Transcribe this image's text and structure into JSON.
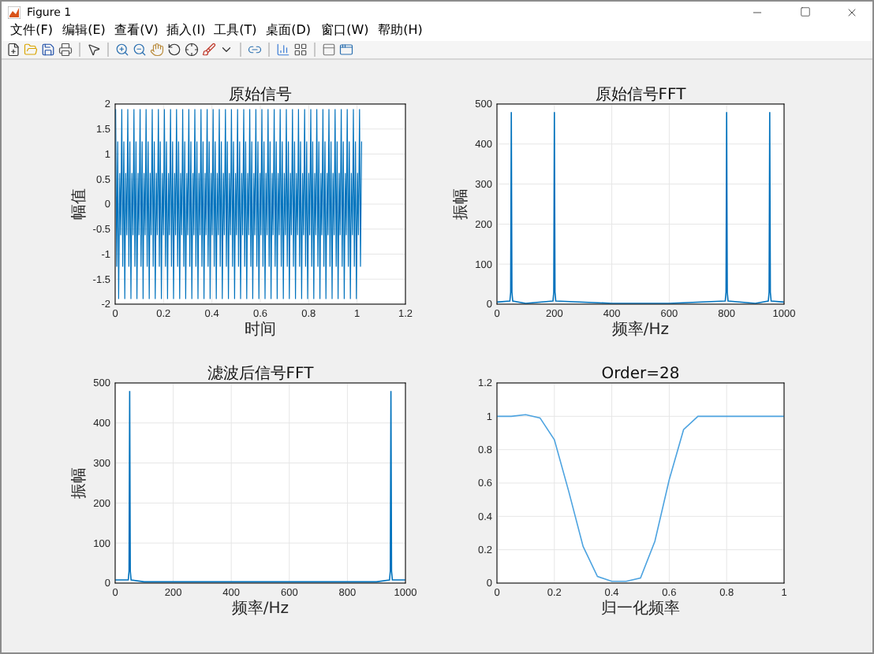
{
  "window": {
    "title": "Figure 1"
  },
  "menu": [
    {
      "label": "文件(F)"
    },
    {
      "label": "编辑(E)"
    },
    {
      "label": "查看(V)"
    },
    {
      "label": "插入(I)"
    },
    {
      "label": "工具(T)"
    },
    {
      "label": "桌面(D)"
    },
    {
      "label": "窗口(W)"
    },
    {
      "label": "帮助(H)"
    }
  ],
  "plots": [
    {
      "kind": "waveform",
      "axes": {
        "title": "原始信号",
        "xlabel": "时间",
        "ylabel": "幅值",
        "grid": true,
        "xticks": [
          "0",
          "0.2",
          "0.4",
          "0.6",
          "0.8",
          "1",
          "1.2"
        ],
        "yticks": [
          "2",
          "1.5",
          "1",
          "0.5",
          "0",
          "-0.5",
          "-1",
          "-1.5",
          "-2"
        ]
      }
    },
    {
      "kind": "chart",
      "chart_data": {
        "type": "line",
        "title": "原始信号FFT",
        "xlabel": "频率/Hz",
        "ylabel": "振幅",
        "grid": true,
        "xlim": [
          0,
          1000
        ],
        "ylim": [
          0,
          500
        ],
        "xticks": [
          {
            "value": 0,
            "label": "0"
          },
          {
            "value": 200,
            "label": "200"
          },
          {
            "value": 400,
            "label": "400"
          },
          {
            "value": 600,
            "label": "600"
          },
          {
            "value": 800,
            "label": "800"
          },
          {
            "value": 1000,
            "label": "1000"
          }
        ],
        "yticks": [
          {
            "value": 0,
            "label": "0"
          },
          {
            "value": 100,
            "label": "100"
          },
          {
            "value": 200,
            "label": "200"
          },
          {
            "value": 300,
            "label": "300"
          },
          {
            "value": 400,
            "label": "400"
          },
          {
            "value": 500,
            "label": "500"
          }
        ],
        "x": [
          0,
          45,
          48,
          50,
          52,
          55,
          100,
          195,
          198,
          200,
          202,
          205,
          400,
          600,
          795,
          798,
          800,
          802,
          805,
          900,
          945,
          948,
          950,
          952,
          955,
          1000
        ],
        "series": [
          {
            "color": "#0072bd",
            "values": [
              5,
              8,
              30,
              480,
              30,
              8,
              2,
              8,
              30,
              480,
              30,
              8,
              2,
              2,
              8,
              30,
              480,
              30,
              8,
              2,
              8,
              30,
              480,
              30,
              8,
              5
            ]
          }
        ]
      }
    },
    {
      "kind": "chart",
      "chart_data": {
        "type": "line",
        "title": "滤波后信号FFT",
        "xlabel": "频率/Hz",
        "ylabel": "振幅",
        "grid": true,
        "xlim": [
          0,
          1000
        ],
        "ylim": [
          0,
          500
        ],
        "xticks": [
          {
            "value": 0,
            "label": "0"
          },
          {
            "value": 200,
            "label": "200"
          },
          {
            "value": 400,
            "label": "400"
          },
          {
            "value": 600,
            "label": "600"
          },
          {
            "value": 800,
            "label": "800"
          },
          {
            "value": 1000,
            "label": "1000"
          }
        ],
        "yticks": [
          {
            "value": 0,
            "label": "0"
          },
          {
            "value": 100,
            "label": "100"
          },
          {
            "value": 200,
            "label": "200"
          },
          {
            "value": 300,
            "label": "300"
          },
          {
            "value": 400,
            "label": "400"
          },
          {
            "value": 500,
            "label": "500"
          }
        ],
        "x": [
          0,
          45,
          48,
          50,
          52,
          55,
          100,
          900,
          945,
          948,
          950,
          952,
          955,
          1000
        ],
        "series": [
          {
            "color": "#0072bd",
            "values": [
              8,
              8,
              30,
              480,
              30,
              8,
              3,
              3,
              8,
              30,
              480,
              30,
              8,
              8
            ]
          }
        ]
      }
    },
    {
      "kind": "chart",
      "chart_data": {
        "type": "line",
        "title": "Order=28",
        "xlabel": "归一化频率",
        "grid": true,
        "xlim": [
          0,
          1
        ],
        "ylim": [
          0,
          1.2
        ],
        "xticks": [
          {
            "value": 0,
            "label": "0"
          },
          {
            "value": 0.2,
            "label": "0.2"
          },
          {
            "value": 0.4,
            "label": "0.4"
          },
          {
            "value": 0.6,
            "label": "0.6"
          },
          {
            "value": 0.8,
            "label": "0.8"
          },
          {
            "value": 1,
            "label": "1"
          }
        ],
        "yticks": [
          {
            "value": 0,
            "label": "0"
          },
          {
            "value": 0.2,
            "label": "0.2"
          },
          {
            "value": 0.4,
            "label": "0.4"
          },
          {
            "value": 0.6,
            "label": "0.6"
          },
          {
            "value": 0.8,
            "label": "0.8"
          },
          {
            "value": 1,
            "label": "1"
          },
          {
            "value": 1.2,
            "label": "1.2"
          }
        ],
        "x": [
          0,
          0.05,
          0.1,
          0.15,
          0.2,
          0.25,
          0.3,
          0.35,
          0.4,
          0.45,
          0.5,
          0.55,
          0.6,
          0.65,
          0.7,
          0.75,
          0.8,
          0.85,
          0.9,
          0.95,
          1
        ],
        "series": [
          {
            "color": "#4da3e0",
            "values": [
              1,
              1,
              1.01,
              0.99,
              0.86,
              0.55,
              0.22,
              0.04,
              0.01,
              0.01,
              0.03,
              0.25,
              0.62,
              0.92,
              1,
              1,
              1,
              1,
              1,
              1,
              1
            ]
          }
        ]
      }
    }
  ]
}
